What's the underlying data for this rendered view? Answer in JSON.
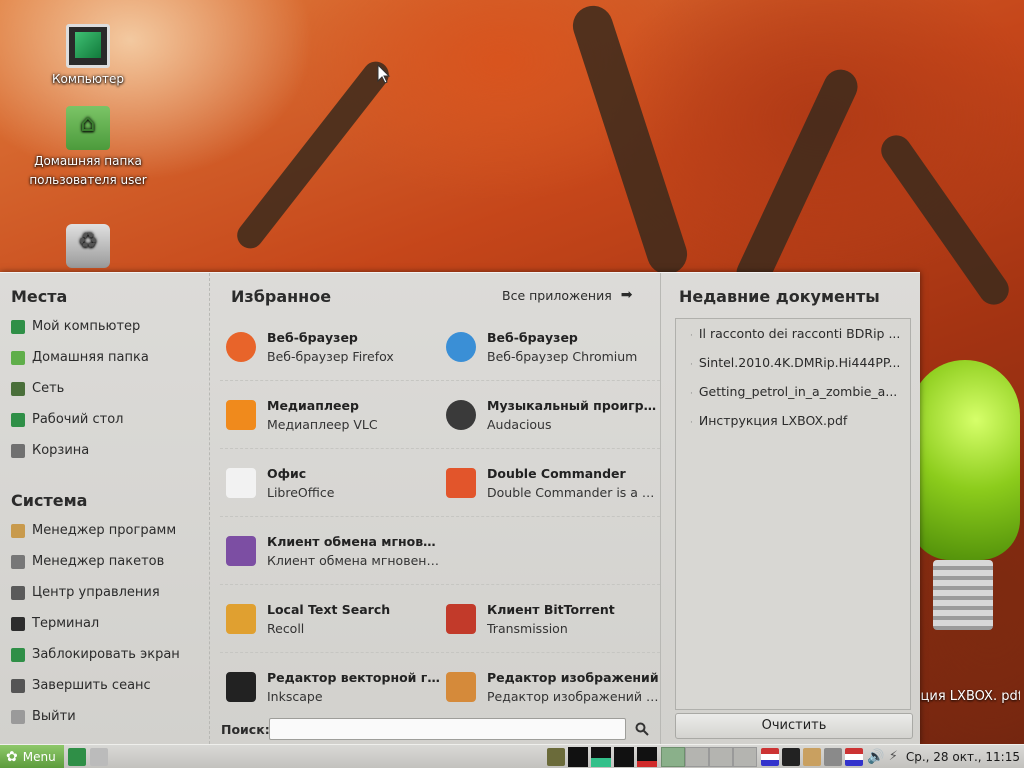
{
  "desktop": {
    "icons": [
      {
        "label": "Компьютер"
      },
      {
        "label": "Домашняя папка пользователя user"
      },
      {
        "label": ""
      }
    ],
    "pdf_label": "укция LXBOX. pdf"
  },
  "menu": {
    "places": {
      "title": "Места",
      "items": [
        {
          "label": "Мой компьютер",
          "icon": "computer-icon",
          "color": "#2f8f47"
        },
        {
          "label": "Домашняя папка",
          "icon": "home-folder-icon",
          "color": "#5fae4a"
        },
        {
          "label": "Сеть",
          "icon": "network-icon",
          "color": "#4a6f3a"
        },
        {
          "label": "Рабочий стол",
          "icon": "desktop-icon",
          "color": "#2f8f47"
        },
        {
          "label": "Корзина",
          "icon": "trash-icon",
          "color": "#707070"
        }
      ]
    },
    "system": {
      "title": "Система",
      "items": [
        {
          "label": "Менеджер программ",
          "icon": "software-manager-icon",
          "color": "#c89a4c"
        },
        {
          "label": "Менеджер пакетов",
          "icon": "package-manager-icon",
          "color": "#777777"
        },
        {
          "label": "Центр управления",
          "icon": "control-center-icon",
          "color": "#5a5a5a"
        },
        {
          "label": "Терминал",
          "icon": "terminal-icon",
          "color": "#2d2d2d"
        },
        {
          "label": "Заблокировать экран",
          "icon": "lock-screen-icon",
          "color": "#2f8f47"
        },
        {
          "label": "Завершить сеанс",
          "icon": "logout-icon",
          "color": "#555555"
        },
        {
          "label": "Выйти",
          "icon": "power-icon",
          "color": "#9a9a9a"
        }
      ]
    },
    "favorites": {
      "title": "Избранное",
      "all_apps": "Все приложения",
      "items": [
        {
          "name": "Веб-браузер",
          "desc": "Веб-браузер Firefox",
          "icon": "firefox-icon",
          "color": "#e8642a"
        },
        {
          "name": "Веб-браузер",
          "desc": "Веб-браузер Chromium",
          "icon": "chromium-icon",
          "color": "#3a8fd6"
        },
        {
          "name": "Медиаплеер",
          "desc": "Медиаплеер VLC",
          "icon": "vlc-icon",
          "color": "#f08a1c"
        },
        {
          "name": "Музыкальный проигрыв...",
          "desc": "Audacious",
          "icon": "audacious-icon",
          "color": "#3a3a3a"
        },
        {
          "name": "Офис",
          "desc": "LibreOffice",
          "icon": "libreoffice-icon",
          "color": "#f2f2f2"
        },
        {
          "name": "Double Commander",
          "desc": "Double Commander is a cro...",
          "icon": "double-commander-icon",
          "color": "#e2552b"
        },
        {
          "name": "Клиент обмена мгновен...",
          "desc": "Клиент обмена мгновенн...",
          "icon": "pidgin-icon",
          "color": "#7c4ea3"
        },
        {
          "name": "",
          "desc": "",
          "icon": "",
          "color": ""
        },
        {
          "name": "Local Text Search",
          "desc": "Recoll",
          "icon": "recoll-icon",
          "color": "#e0a030"
        },
        {
          "name": "Клиент BitTorrent",
          "desc": "Transmission",
          "icon": "transmission-icon",
          "color": "#c23a2a"
        },
        {
          "name": "Редактор векторной гра...",
          "desc": "Inkscape",
          "icon": "inkscape-icon",
          "color": "#222222"
        },
        {
          "name": "Редактор изображений",
          "desc": "Редактор изображений GI...",
          "icon": "gimp-icon",
          "color": "#d58a3a"
        }
      ]
    },
    "recent": {
      "title": "Недавние документы",
      "items": [
        "Il racconto dei racconti BDRip ...",
        "Sintel.2010.4K.DMRip.Hi444PP...",
        "Getting_petrol_in_a_zombie_a...",
        "Инструкция LXBOX.pdf"
      ],
      "clear_label": "Очистить"
    },
    "search": {
      "label": "Поиск:",
      "value": ""
    }
  },
  "taskbar": {
    "menu_label": "Menu",
    "clock": "Ср., 28 окт., 11:15"
  }
}
